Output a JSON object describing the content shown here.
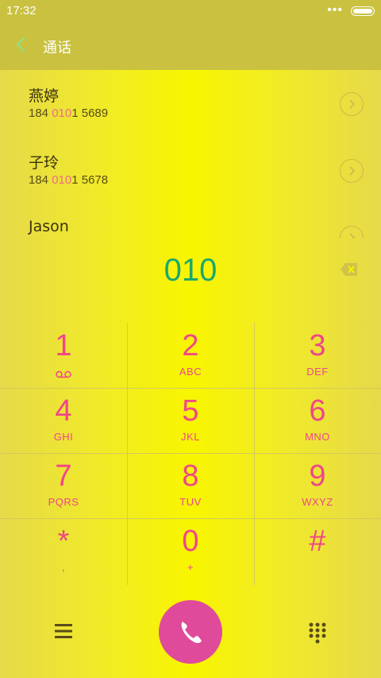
{
  "status_bar": {
    "time": "17:32",
    "more": "•••"
  },
  "header": {
    "title": "通话"
  },
  "contacts": [
    {
      "name": "燕婷",
      "number_pre": "184 ",
      "number_match": "010",
      "number_post": "1 5689"
    },
    {
      "name": "子玲",
      "number_pre": "184 ",
      "number_match": "010",
      "number_post": "1 5678"
    },
    {
      "name": "Jason"
    }
  ],
  "dialer": {
    "number": "010"
  },
  "keypad": [
    {
      "digit": "1",
      "letters": ""
    },
    {
      "digit": "2",
      "letters": "ABC"
    },
    {
      "digit": "3",
      "letters": "DEF"
    },
    {
      "digit": "4",
      "letters": "GHI"
    },
    {
      "digit": "5",
      "letters": "JKL"
    },
    {
      "digit": "6",
      "letters": "MNO"
    },
    {
      "digit": "7",
      "letters": "PQRS"
    },
    {
      "digit": "8",
      "letters": "TUV"
    },
    {
      "digit": "9",
      "letters": "WXYZ"
    },
    {
      "digit": "*",
      "letters": ","
    },
    {
      "digit": "0",
      "letters": "+"
    },
    {
      "digit": "#",
      "letters": ""
    }
  ],
  "icons": {
    "back": "chevron-left-icon",
    "backspace": "backspace-icon",
    "voicemail": "voicemail-icon",
    "menu": "menu-icon",
    "call": "phone-icon",
    "dialpad": "dialpad-icon"
  },
  "colors": {
    "accent_digit": "#f0468a",
    "dial_number": "#1aa86e",
    "call_button": "#e04a9a",
    "header_bg": "#c9c13f"
  }
}
